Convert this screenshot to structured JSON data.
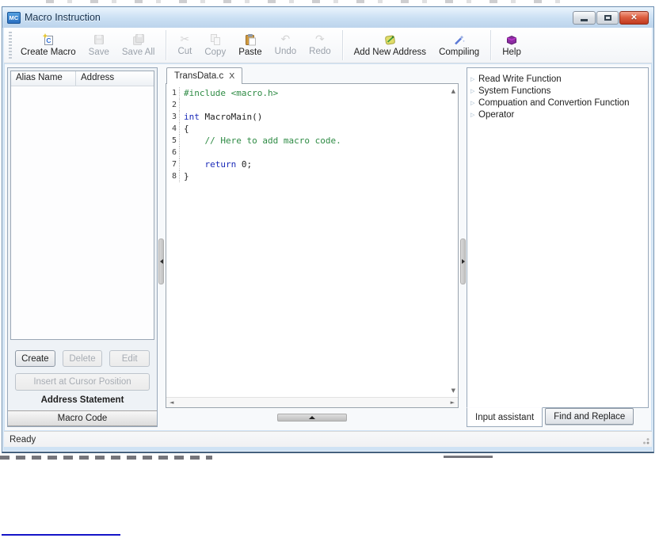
{
  "window": {
    "title": "Macro Instruction",
    "icon_text": "MC"
  },
  "toolbar": {
    "items": [
      {
        "label": "Create Macro",
        "enabled": true
      },
      {
        "label": "Save",
        "enabled": false
      },
      {
        "label": "Save All",
        "enabled": false
      },
      {
        "label": "Cut",
        "enabled": false
      },
      {
        "label": "Copy",
        "enabled": false
      },
      {
        "label": "Paste",
        "enabled": true
      },
      {
        "label": "Undo",
        "enabled": false
      },
      {
        "label": "Redo",
        "enabled": false
      },
      {
        "label": "Add New Address",
        "enabled": true
      },
      {
        "label": "Compiling",
        "enabled": true
      },
      {
        "label": "Help",
        "enabled": true
      }
    ]
  },
  "left_panel": {
    "table_headers": [
      "Alias Name",
      "Address"
    ],
    "buttons": {
      "create": "Create",
      "delete": "Delete",
      "edit": "Edit",
      "insert": "Insert at Cursor Position"
    },
    "caption": "Address Statement",
    "macro_code": "Macro Code"
  },
  "editor": {
    "tab": "TransData.c",
    "tab_close": "X",
    "lines": [
      {
        "num": "1",
        "segments": [
          {
            "text": "#include <macro.h>",
            "style": "green"
          }
        ]
      },
      {
        "num": "2",
        "segments": []
      },
      {
        "num": "3",
        "segments": [
          {
            "text": "int",
            "style": "blue"
          },
          {
            "text": " MacroMain()",
            "style": "plain"
          }
        ]
      },
      {
        "num": "4",
        "segments": [
          {
            "text": "{",
            "style": "plain"
          }
        ]
      },
      {
        "num": "5",
        "segments": [
          {
            "text": "    ",
            "style": "plain"
          },
          {
            "text": "// Here to add macro code.",
            "style": "green"
          }
        ]
      },
      {
        "num": "6",
        "segments": []
      },
      {
        "num": "7",
        "segments": [
          {
            "text": "    ",
            "style": "plain"
          },
          {
            "text": "return",
            "style": "blue"
          },
          {
            "text": " 0;",
            "style": "plain"
          }
        ]
      },
      {
        "num": "8",
        "segments": [
          {
            "text": "}",
            "style": "plain"
          }
        ]
      }
    ]
  },
  "right_panel": {
    "tree": [
      "Read Write Function",
      "System Functions",
      "Compuation and Convertion Function",
      "Operator"
    ],
    "tabs": [
      "Input assistant",
      "Find and Replace"
    ]
  },
  "statusbar": {
    "text": "Ready"
  },
  "colors": {
    "titlebar": "#cadff3",
    "close_button": "#dd5f41",
    "code_green": "#2e8b44",
    "code_blue": "#1a2ab8",
    "frame": "#cfe2f4"
  }
}
